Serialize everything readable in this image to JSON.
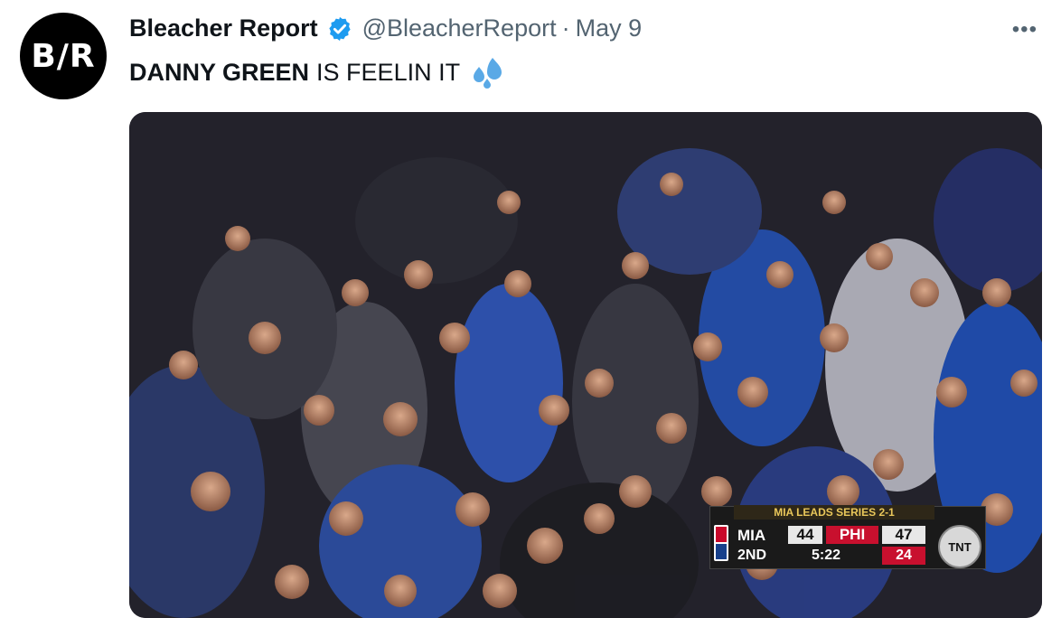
{
  "tweet": {
    "author_name": "Bleacher Report",
    "handle": "@BleacherReport",
    "separator": "·",
    "date": "May 9",
    "avatar_text": "B/R",
    "more_label": "•••",
    "text_bold": "DANNY GREEN",
    "text_rest": "IS FEELIN IT"
  },
  "scorebug": {
    "series": "MIA LEADS SERIES 2-1",
    "home_team": "MIA",
    "home_score": "44",
    "away_team": "PHI",
    "away_score": "47",
    "quarter": "2ND",
    "clock": "5:22",
    "shot_clock": "24",
    "network": "TNT"
  },
  "colors": {
    "verified": "#1d9bf0",
    "sweat": "#5aa9e6",
    "phi_red": "#c8102e"
  },
  "icons": [
    "verified-badge-icon",
    "sweat-droplets-icon",
    "more-icon",
    "nba-logo-icon"
  ]
}
